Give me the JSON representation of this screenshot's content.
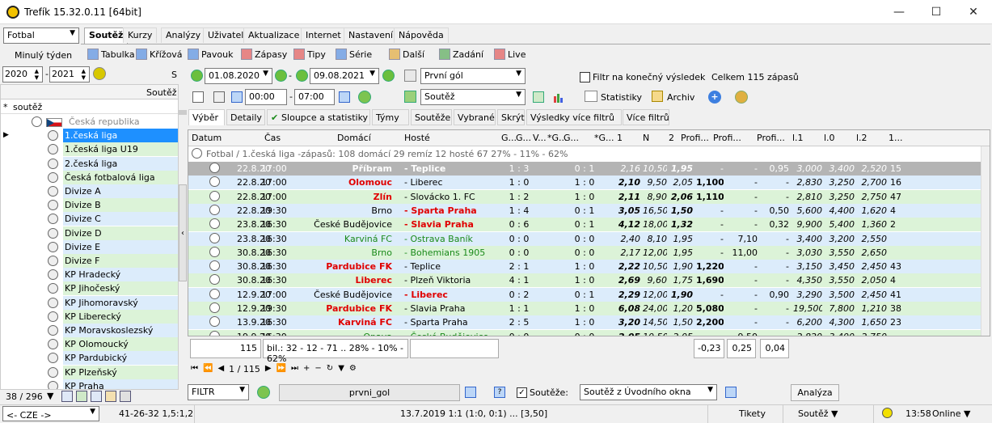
{
  "window": {
    "title": "Trefík 15.32.0.11 [64bit]"
  },
  "left": {
    "sport": "Fotbal",
    "week_btn": "Minulý týden",
    "year_from": "2020",
    "year_to": "2021",
    "header_col": "Soutěž",
    "filter_text": "soutěž",
    "count": "38 / 296"
  },
  "tree": [
    {
      "label": "Česká republika",
      "cls": "",
      "flag": true
    },
    {
      "label": "1.česká liga",
      "cls": "selblue"
    },
    {
      "label": "1.česká liga U19",
      "cls": "green"
    },
    {
      "label": "2.česká liga",
      "cls": "blue"
    },
    {
      "label": "Česká fotbalová liga",
      "cls": "green"
    },
    {
      "label": "Divize A",
      "cls": "blue"
    },
    {
      "label": "Divize B",
      "cls": "green"
    },
    {
      "label": "Divize C",
      "cls": "blue"
    },
    {
      "label": "Divize D",
      "cls": "green"
    },
    {
      "label": "Divize E",
      "cls": "blue"
    },
    {
      "label": "Divize F",
      "cls": "green"
    },
    {
      "label": "KP Hradecký",
      "cls": "blue"
    },
    {
      "label": "KP Jihočeský",
      "cls": "green"
    },
    {
      "label": "KP Jihomoravský",
      "cls": "blue"
    },
    {
      "label": "KP Liberecký",
      "cls": "green"
    },
    {
      "label": "KP Moravskoslezský",
      "cls": "blue"
    },
    {
      "label": "KP Olomoucký",
      "cls": "green"
    },
    {
      "label": "KP Pardubický",
      "cls": "blue"
    },
    {
      "label": "KP Plzeňský",
      "cls": "green"
    },
    {
      "label": "KP Praha",
      "cls": "blue"
    }
  ],
  "menu": [
    "Soutěž",
    "Kurzy",
    "Analýzy",
    "Uživatel",
    "Aktualizace",
    "Internet",
    "Nastavení",
    "Nápověda"
  ],
  "toolbar": [
    "Tabulka",
    "Křížová",
    "Pavouk",
    "Zápasy",
    "Tipy",
    "Série",
    "Další",
    "Zadání",
    "Live"
  ],
  "filter": {
    "date_from": "01.08.2020",
    "date_to": "09.08.2021",
    "goal": "První gól",
    "comp": "Soutěž",
    "time_from": "00:00",
    "time_to": "07:00",
    "final_chk": "Filtr na konečný výsledek",
    "total": "Celkem 115 zápasů",
    "stats": "Statistiky",
    "archive": "Archiv"
  },
  "subtabs": [
    "Výběr",
    "Detaily",
    "Sloupce a statistiky",
    "Týmy",
    "Soutěže",
    "Vybrané",
    "Skrýt",
    "Výsledky více filtrů",
    "Více filtrů"
  ],
  "grid": {
    "headers": [
      "Datum",
      "Čas",
      "Domácí",
      "Hosté",
      "G...",
      "G...",
      "V...",
      "*G...",
      "G...",
      "*G...",
      "1",
      "N",
      "2",
      "Profi...",
      "Profi...",
      "Profi...",
      "l.1",
      "l.0",
      "l.2",
      "1..."
    ],
    "group": "Fotbal / 1.česká liga -zápasů: 108  domácí 29  remíz 12  hosté 67      27% - 11% - 62%",
    "rows": [
      [
        "22.8.20",
        "17:00",
        "Příbram",
        "Teplice",
        "1 : 3",
        "0 : 1",
        "2,16",
        "10,50",
        "1,95",
        "-",
        "-",
        "0,95",
        "3,000",
        "3,400",
        "2,520",
        "15"
      ],
      [
        "22.8.20",
        "17:00",
        "Olomouc",
        "Liberec",
        "1 : 0",
        "1 : 0",
        "2,10",
        "9,50",
        "2,05",
        "1,100",
        "-",
        "-",
        "2,830",
        "3,250",
        "2,700",
        "16"
      ],
      [
        "22.8.20",
        "17:00",
        "Zlín",
        "Slovácko 1. FC",
        "1 : 2",
        "1 : 0",
        "2,11",
        "8,90",
        "2,06",
        "1,110",
        "-",
        "-",
        "2,810",
        "3,250",
        "2,750",
        "47"
      ],
      [
        "22.8.20",
        "19:30",
        "Brno",
        "Sparta Praha",
        "1 : 4",
        "0 : 1",
        "3,05",
        "16,50",
        "1,50",
        "-",
        "-",
        "0,50",
        "5,600",
        "4,400",
        "1,620",
        "4"
      ],
      [
        "23.8.20",
        "16:30",
        "České Budějovice",
        "Slavia Praha",
        "0 : 6",
        "0 : 1",
        "4,12",
        "18,00",
        "1,32",
        "-",
        "-",
        "0,32",
        "9,900",
        "5,400",
        "1,360",
        "2"
      ],
      [
        "23.8.20",
        "16:30",
        "Karviná FC",
        "Ostrava Baník",
        "0 : 0",
        "0 : 0",
        "2,40",
        "8,10",
        "1,95",
        "-",
        "7,10",
        "-",
        "3,400",
        "3,200",
        "2,550",
        ""
      ],
      [
        "30.8.20",
        "16:30",
        "Brno",
        "Bohemians 1905",
        "0 : 0",
        "0 : 0",
        "2,17",
        "12,00",
        "1,95",
        "-",
        "11,00",
        "-",
        "3,030",
        "3,550",
        "2,650",
        ""
      ],
      [
        "30.8.20",
        "16:30",
        "Pardubice FK",
        "Teplice",
        "2 : 1",
        "1 : 0",
        "2,22",
        "10,50",
        "1,90",
        "1,220",
        "-",
        "-",
        "3,150",
        "3,450",
        "2,450",
        "43"
      ],
      [
        "30.8.20",
        "16:30",
        "Liberec",
        "Plzeň Viktoria",
        "4 : 1",
        "1 : 0",
        "2,69",
        "9,60",
        "1,75",
        "1,690",
        "-",
        "-",
        "4,350",
        "3,550",
        "2,050",
        "4"
      ],
      [
        "12.9.20",
        "17:00",
        "České Budějovice",
        "Liberec",
        "0 : 2",
        "0 : 1",
        "2,29",
        "12,00",
        "1,90",
        "-",
        "-",
        "0,90",
        "3,290",
        "3,500",
        "2,450",
        "41"
      ],
      [
        "12.9.20",
        "19:30",
        "Pardubice FK",
        "Slavia Praha",
        "1 : 1",
        "1 : 0",
        "6,08",
        "24,00",
        "1,20",
        "5,080",
        "-",
        "-",
        "19,500",
        "7,800",
        "1,210",
        "38"
      ],
      [
        "13.9.20",
        "16:30",
        "Karviná FC",
        "Sparta Praha",
        "2 : 5",
        "1 : 0",
        "3,20",
        "14,50",
        "1,50",
        "2,200",
        "-",
        "-",
        "6,200",
        "4,300",
        "1,650",
        "23"
      ],
      [
        "19.9.20",
        "16:30",
        "Opava",
        "České Budějovice",
        "0 : 0",
        "0 : 0",
        "2,05",
        "10,50",
        "2,05",
        "-",
        "9,50",
        "-",
        "2,820",
        "3,400",
        "2,750",
        ""
      ]
    ]
  },
  "summary": {
    "count": "115",
    "desc": "bil.: 32 - 12 - 71 .. 28% - 10% - 62%",
    "p1": "-0,23",
    "p2": "0,25",
    "p3": "0,04"
  },
  "nav": {
    "pos": "1 / 115"
  },
  "bottom": {
    "filtr": "FILTR",
    "name": "prvni_gol",
    "comp_lbl": "Soutěže:",
    "comp_val": "Soutěž z Úvodního okna",
    "analyze": "Analýza"
  },
  "status": {
    "cze": "<- CZE ->",
    "score": "41-26-32  1,5:1,2",
    "info": "13.7.2019 1:1 (1:0, 0:1) ... [3,50]",
    "tikety": "Tikety",
    "soutez": "Soutěž ▼",
    "time": "13:58",
    "online": "Online ▼"
  }
}
